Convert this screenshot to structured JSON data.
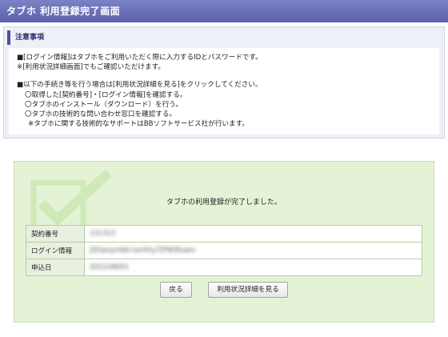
{
  "header": {
    "title": "タブホ 利用登録完了画面"
  },
  "notice": {
    "heading": "注意事項",
    "lines": [
      "■[ログイン情報]はタブホをご利用いただく際に入力するIDとパスワードです。",
      "※[利用状況詳細画面]でもご確認いただけます。",
      "■以下の手続き等を行う場合は[利用状況詳細を見る]をクリックしてください。",
      "〇取得した[契約番号]・[ログイン情報]を確認する。",
      "〇タブホのインストール（ダウンロード）を行う。",
      "〇タブホの技術的な問い合わせ窓口を確認する。",
      "※タブホに関する技術的なサポートはBBソフトサービス社が行います。"
    ]
  },
  "panel": {
    "message": "タブホの利用登録が完了しました。",
    "rows": [
      {
        "label": "契約番号",
        "value": "131313"
      },
      {
        "label": "ログイン情報",
        "value": "[ID]aoymbb-tanhhy7[PW]feaen"
      },
      {
        "label": "申込日",
        "value": "2021/08/01"
      }
    ],
    "buttons": {
      "back": "戻る",
      "details": "利用状況詳細を見る"
    }
  },
  "colors": {
    "title_bar": "#6a70b8",
    "panel_bg": "#e4f3d5",
    "notice_bg": "#eef0f8"
  }
}
